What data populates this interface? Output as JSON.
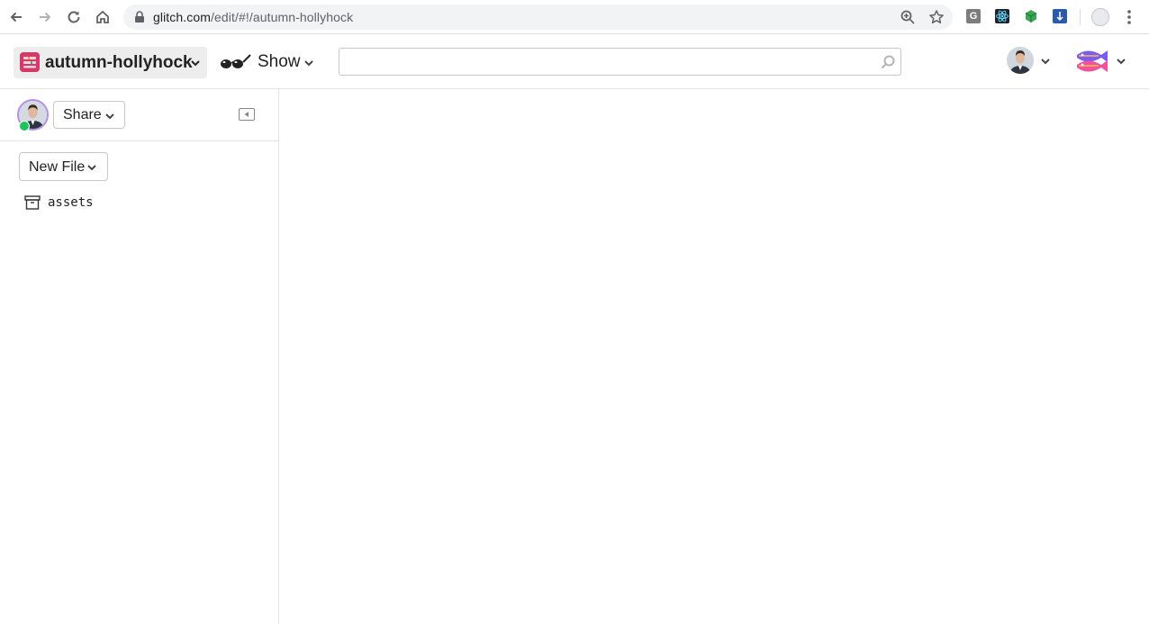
{
  "browser": {
    "url_host": "glitch.com",
    "url_path": "/edit/#!/autumn-hollyhock",
    "extension_g_label": "G",
    "icons": [
      "back-arrow-icon",
      "forward-arrow-icon",
      "reload-icon",
      "home-icon",
      "lock-icon",
      "zoom-icon",
      "bookmark-star-icon",
      "kebab-menu-icon"
    ]
  },
  "header": {
    "project_name": "autumn-hollyhock",
    "show_label": "Show",
    "search_value": "",
    "search_placeholder": ""
  },
  "sidebar": {
    "share_label": "Share",
    "new_file_label": "New File",
    "files": [
      {
        "name": "assets",
        "icon": "archive-box-icon"
      }
    ]
  },
  "colors": {
    "project_icon": "#d23a6a",
    "online_status": "#1cc45c",
    "avatar_ring": "#b78ee8"
  }
}
